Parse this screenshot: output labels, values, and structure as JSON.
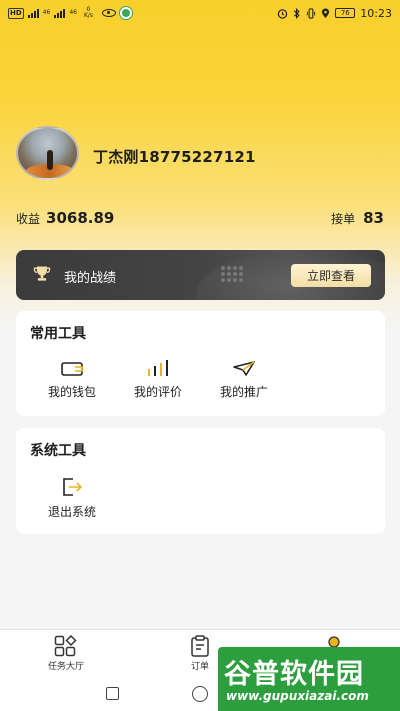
{
  "status_bar": {
    "left_badges": [
      "HD",
      "46",
      "46"
    ],
    "net_speed": "0\nK/s",
    "battery": "76",
    "time": "10:23"
  },
  "profile": {
    "name": "丁杰刚18775227121"
  },
  "stats": {
    "income_label": "收益",
    "income_value": "3068.89",
    "orders_label": "接单",
    "orders_value": "83"
  },
  "achievement": {
    "title": "我的战绩",
    "button": "立即查看"
  },
  "common_tools": {
    "title": "常用工具",
    "items": [
      {
        "label": "我的钱包",
        "icon": "wallet-icon"
      },
      {
        "label": "我的评价",
        "icon": "bar-chart-icon"
      },
      {
        "label": "我的推广",
        "icon": "paper-plane-icon"
      }
    ]
  },
  "system_tools": {
    "title": "系统工具",
    "items": [
      {
        "label": "退出系统",
        "icon": "logout-icon"
      }
    ]
  },
  "bottom_nav": {
    "items": [
      {
        "label": "任务大厅",
        "icon": "grid-icon"
      },
      {
        "label": "订单",
        "icon": "clipboard-icon"
      },
      {
        "label": "",
        "icon": "profile-icon"
      }
    ]
  },
  "watermark": {
    "title": "谷普软件园",
    "url": "www.gupuxiazai.com"
  },
  "colors": {
    "brand_yellow": "#f9cf2b",
    "dark_bar": "#3b3b3b",
    "watermark_green": "#2d9e3e"
  }
}
